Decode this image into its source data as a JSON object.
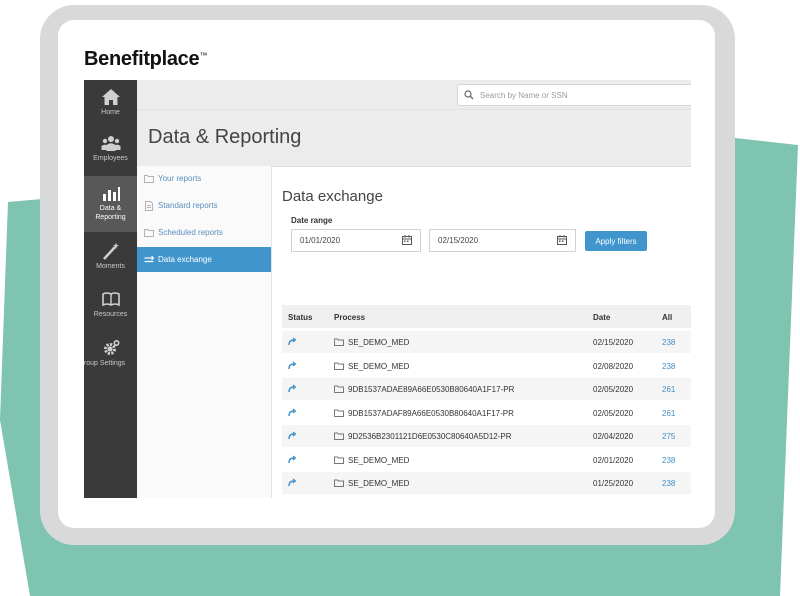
{
  "brand": {
    "logo_text": "Benefitplace",
    "logo_mark": "™"
  },
  "search": {
    "placeholder": "Search by Name or SSN"
  },
  "nav": [
    {
      "label": "Home",
      "icon": "home-icon"
    },
    {
      "label": "Employees",
      "icon": "employees-icon"
    },
    {
      "label": "Data &",
      "label2": "Reporting",
      "icon": "bar-chart-icon"
    },
    {
      "label": "Moments",
      "icon": "magic-wand-icon"
    },
    {
      "label": "Resources",
      "icon": "book-icon"
    },
    {
      "label": "roup Settings",
      "icon": "gear-icon"
    }
  ],
  "header": {
    "title": "Data & Reporting"
  },
  "subnav": [
    {
      "label": "Your reports",
      "icon": "folder-icon"
    },
    {
      "label": "Standard reports",
      "icon": "document-icon"
    },
    {
      "label": "Scheduled reports",
      "icon": "folder-icon"
    },
    {
      "label": "Data exchange",
      "icon": "exchange-icon"
    }
  ],
  "main": {
    "title": "Data exchange",
    "range_label": "Date range",
    "date_from": "01/01/2020",
    "date_to": "02/15/2020",
    "apply_label": "Apply filters"
  },
  "table": {
    "headers": [
      "Status",
      "Process",
      "Date",
      "All"
    ],
    "rows": [
      {
        "process": "SE_DEMO_MED",
        "date": "02/15/2020",
        "all": "238"
      },
      {
        "process": "SE_DEMO_MED",
        "date": "02/08/2020",
        "all": "238"
      },
      {
        "process": "9DB1537ADAE89A66E0530B80640A1F17-PR",
        "date": "02/05/2020",
        "all": "261"
      },
      {
        "process": "9DB1537ADAF89A66E0530B80640A1F17-PR",
        "date": "02/05/2020",
        "all": "261"
      },
      {
        "process": "9D2536B2301121D6E0530C80640A5D12-PR",
        "date": "02/04/2020",
        "all": "275"
      },
      {
        "process": "SE_DEMO_MED",
        "date": "02/01/2020",
        "all": "238"
      },
      {
        "process": "SE_DEMO_MED",
        "date": "01/25/2020",
        "all": "238"
      }
    ]
  },
  "colors": {
    "accent": "#3f95cc",
    "teal": "#7fc4b0",
    "sidebar": "#3a3a3a",
    "link": "#3f8fc7"
  }
}
